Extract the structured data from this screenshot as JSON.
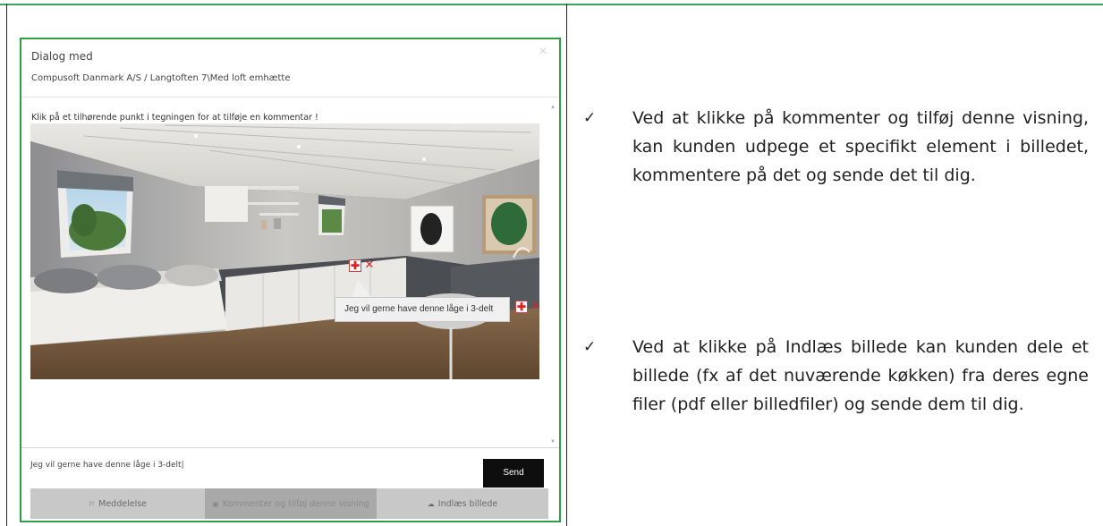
{
  "dialog": {
    "title": "Dialog med",
    "subtitle": "Compusoft Danmark A/S / Langtoften 7\\Med loft emhætte",
    "close_icon": "×",
    "instruction": "Klik på et tilhørende punkt i tegningen for at tilføje en kommentar !",
    "annotation": {
      "tooltip": "Jeg vil gerne have denne låge i 3-delt",
      "add_symbol": "✚",
      "remove_symbol": "✕"
    },
    "message": {
      "value": "Jeg vil gerne have denne låge i 3-delt|",
      "send_label": "Send"
    },
    "tabs": [
      {
        "icon": "⚐",
        "label": "Meddelelse"
      },
      {
        "icon": "▣",
        "label": "Kommenter og tilføj denne visning"
      },
      {
        "icon": "☁",
        "label": "Indlæs billede"
      }
    ]
  },
  "bullets": [
    {
      "check": "✓",
      "text": "Ved at klikke på kommenter og tilføj denne visning, kan kunden udpege et specifikt element i billedet, kommentere på det og sende det til dig."
    },
    {
      "check": "✓",
      "text": "Ved at klikke på Indlæs billede kan kunden dele et billede (fx af det nuværende køkken) fra deres egne filer (pdf eller billedfiler) og sende dem til dig."
    }
  ],
  "colors": {
    "frame_green": "#2f9e45",
    "send_button": "#0e0e0e",
    "tab_bg": "#c8c8c8"
  }
}
